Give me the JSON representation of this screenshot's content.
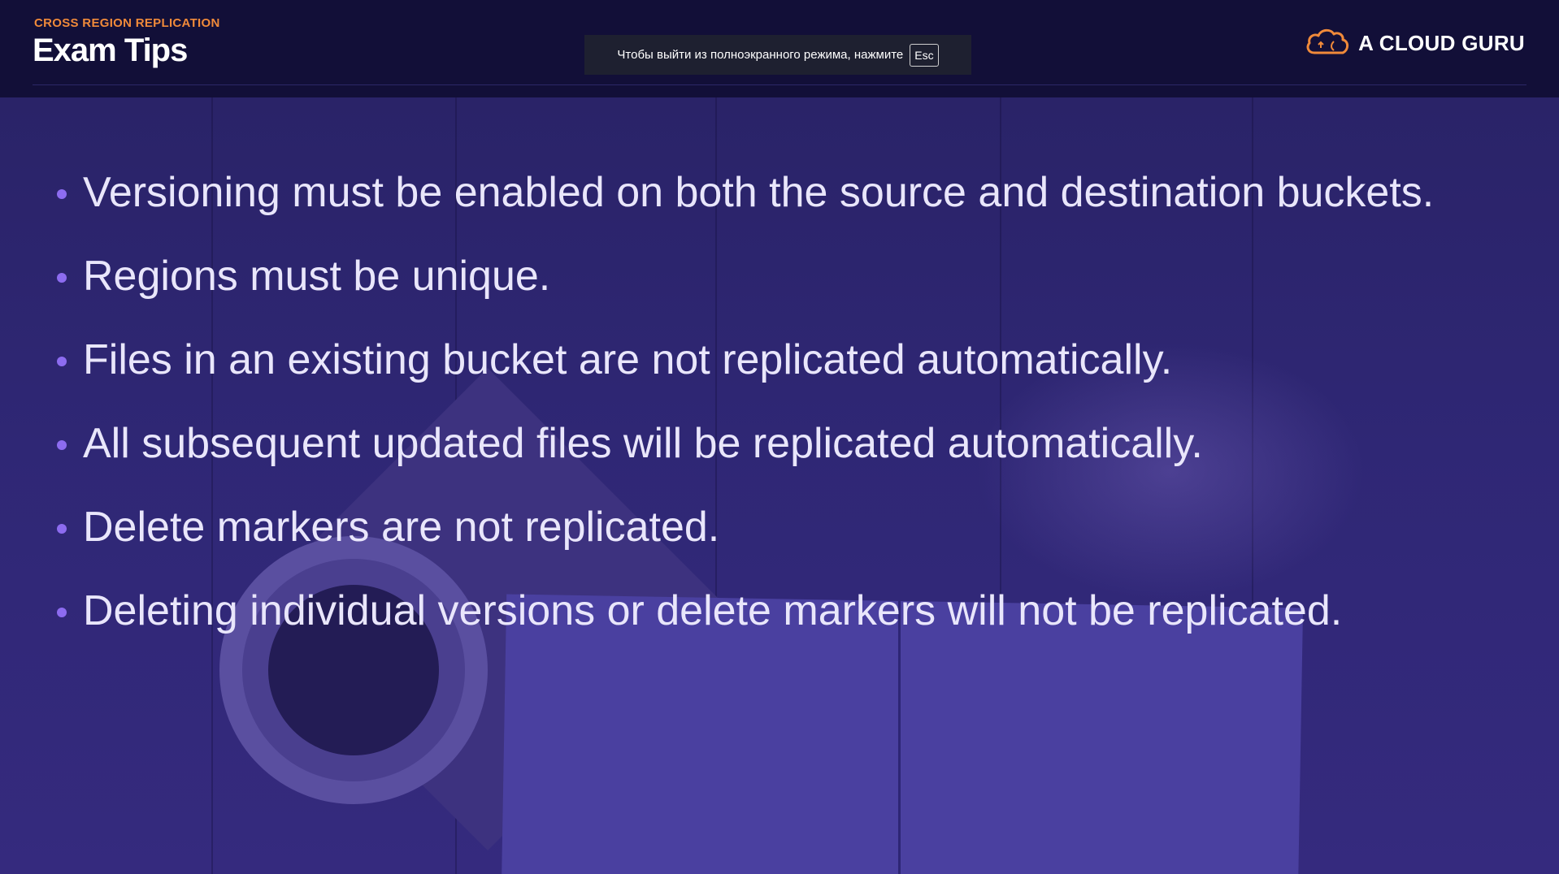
{
  "header": {
    "section_label": "CROSS REGION REPLICATION",
    "title": "Exam Tips"
  },
  "fullscreen_notice": {
    "text": "Чтобы выйти из полноэкранного режима, нажмите",
    "key": "Esc"
  },
  "brand": {
    "name": "A CLOUD GURU",
    "icon": "cloud-logo-icon",
    "color": "#f08a3a"
  },
  "tips": [
    "Versioning must be enabled on both the source and destination buckets.",
    "Regions must be unique.",
    "Files in an existing bucket are not replicated automatically.",
    "All subsequent updated files will be replicated automatically.",
    "Delete markers are not replicated.",
    "Deleting individual versions or delete markers will not be replicated."
  ],
  "colors": {
    "header_bg": "#120f38",
    "accent": "#f08a3a",
    "bullet": "#8d6cf0",
    "overlay": "#2f2775"
  }
}
